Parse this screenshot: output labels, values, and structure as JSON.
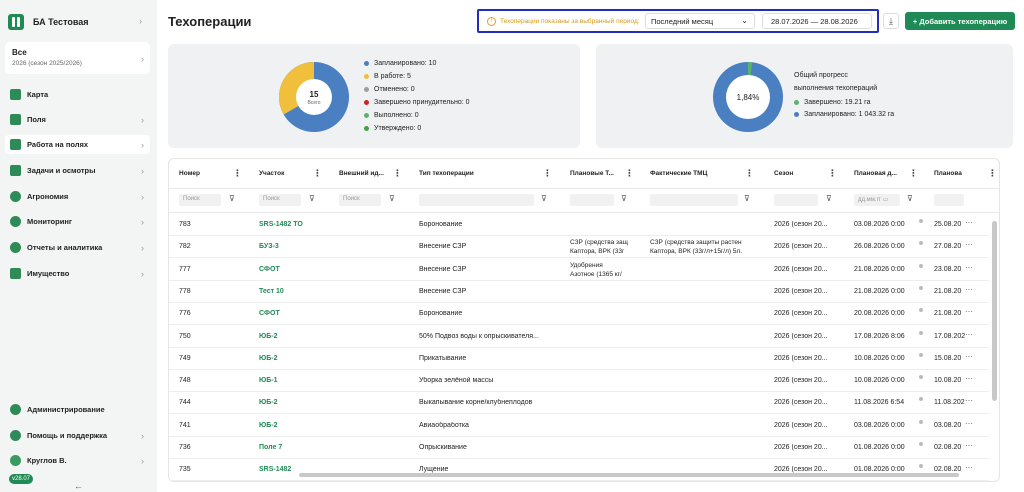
{
  "sidebar": {
    "org_name": "БА Тестовая",
    "season": {
      "title": "Все",
      "subtitle": "2026 (сезон 2025/2026)"
    },
    "items": [
      {
        "label": "Карта",
        "icon": "map-icon"
      },
      {
        "label": "Поля",
        "icon": "fields-icon"
      },
      {
        "label": "Работа на полях",
        "icon": "tractor-icon",
        "active": true
      },
      {
        "label": "Задачи и осмотры",
        "icon": "tasks-icon"
      },
      {
        "label": "Агрономия",
        "icon": "leaf-icon"
      },
      {
        "label": "Мониторинг",
        "icon": "monitoring-icon"
      },
      {
        "label": "Отчеты и аналитика",
        "icon": "chart-icon"
      },
      {
        "label": "Имущество",
        "icon": "warehouse-icon"
      }
    ],
    "bottom": [
      {
        "label": "Администрирование",
        "icon": "gear-icon"
      },
      {
        "label": "Помощь и поддержка",
        "icon": "help-icon"
      },
      {
        "label": "Круглов В.",
        "icon": "avatar"
      }
    ],
    "version": "v28.07"
  },
  "header": {
    "title": "Техоперации",
    "period_note": "Техоперации показаны за выбранный период:",
    "period_value": "Последний месяц",
    "date_range": "28.07.2026 — 28.08.2026",
    "add_button": "+ Добавить техоперацию"
  },
  "status_chart": {
    "center_value": "15",
    "center_label": "Всего",
    "legend": [
      {
        "label": "Запланировано: 10",
        "color": "#4a7fc1"
      },
      {
        "label": "В работе: 5",
        "color": "#f0bf3c"
      },
      {
        "label": "Отменено: 0",
        "color": "#9e9e9e"
      },
      {
        "label": "Завершено принудительно: 0",
        "color": "#c62828"
      },
      {
        "label": "Выполнено: 0",
        "color": "#5cb36d"
      },
      {
        "label": "Утверждено: 0",
        "color": "#43a047"
      }
    ]
  },
  "progress_chart": {
    "center_value": "1,84%",
    "title_line1": "Общий прогресс",
    "title_line2": "выполнения техопераций",
    "legend": [
      {
        "label": "Завершено: 19.21 га",
        "color": "#5cb36d"
      },
      {
        "label": "Запланировано: 1 043.32 га",
        "color": "#4a7fc1"
      }
    ]
  },
  "chart_data": [
    {
      "type": "pie",
      "categories": [
        "Запланировано",
        "В работе"
      ],
      "values": [
        10,
        5
      ]
    },
    {
      "type": "pie",
      "categories": [
        "Завершено",
        "Запланировано"
      ],
      "values": [
        19.21,
        1043.32
      ]
    }
  ],
  "table": {
    "columns": [
      "Номер",
      "Участок",
      "Внешний ид...",
      "Тип техоперации",
      "Плановые Т...",
      "Фактические ТМЦ",
      "Сезон",
      "Плановая д...",
      "Планова"
    ],
    "filters": {
      "number": "Поиск",
      "plot": "Поиск",
      "external": "Поиск",
      "date": "дд.мм.гг"
    },
    "rows": [
      {
        "number": "783",
        "plot": "SRS-1482 TO",
        "type": "Боронование",
        "plan_tmc": "",
        "plan_tmc2": "",
        "fact_tmc": "",
        "fact_tmc2": "",
        "season": "2026 (сезон 20...",
        "plan_date": "03.08.2026 0:00",
        "plan_date2": "25.08.20"
      },
      {
        "number": "782",
        "plot": "БУЗ-3",
        "type": "Внесение СЗР",
        "plan_tmc": "СЗР (средства защ",
        "plan_tmc2": "Каптора, ВРК (33г",
        "fact_tmc": "СЗР (средства защиты растен",
        "fact_tmc2": "Каптора, ВРК (33г/л+15г/л) 5л.",
        "season": "2026 (сезон 20...",
        "plan_date": "26.08.2026 0:00",
        "plan_date2": "27.08.20"
      },
      {
        "number": "777",
        "plot": "СФОТ",
        "type": "Внесение СЗР",
        "plan_tmc": "Удобрения",
        "plan_tmc2": "Азотное (1365 кг/",
        "fact_tmc": "",
        "fact_tmc2": "",
        "season": "2026 (сезон 20...",
        "plan_date": "21.08.2026 0:00",
        "plan_date2": "23.08.20"
      },
      {
        "number": "778",
        "plot": "Тест 10",
        "type": "Внесение СЗР",
        "plan_tmc": "",
        "plan_tmc2": "",
        "fact_tmc": "",
        "fact_tmc2": "",
        "season": "2026 (сезон 20...",
        "plan_date": "21.08.2026 0:00",
        "plan_date2": "21.08.20"
      },
      {
        "number": "776",
        "plot": "СФОТ",
        "type": "Боронование",
        "plan_tmc": "",
        "plan_tmc2": "",
        "fact_tmc": "",
        "fact_tmc2": "",
        "season": "2026 (сезон 20...",
        "plan_date": "20.08.2026 0:00",
        "plan_date2": "21.08.20"
      },
      {
        "number": "750",
        "plot": "ЮБ-2",
        "type": "50% Подвоз воды к опрыскивателя...",
        "plan_tmc": "",
        "plan_tmc2": "",
        "fact_tmc": "",
        "fact_tmc2": "",
        "season": "2026 (сезон 20...",
        "plan_date": "17.08.2026 8:06",
        "plan_date2": "17.08.202"
      },
      {
        "number": "749",
        "plot": "ЮБ-2",
        "type": "Прикатывание",
        "plan_tmc": "",
        "plan_tmc2": "",
        "fact_tmc": "",
        "fact_tmc2": "",
        "season": "2026 (сезон 20...",
        "plan_date": "10.08.2026 0:00",
        "plan_date2": "15.08.20"
      },
      {
        "number": "748",
        "plot": "ЮБ-1",
        "type": "Уборка зелёной массы",
        "plan_tmc": "",
        "plan_tmc2": "",
        "fact_tmc": "",
        "fact_tmc2": "",
        "season": "2026 (сезон 20...",
        "plan_date": "10.08.2026 0:00",
        "plan_date2": "10.08.20"
      },
      {
        "number": "744",
        "plot": "ЮБ-2",
        "type": "Выкапывание корне/клубнеплодов",
        "plan_tmc": "",
        "plan_tmc2": "",
        "fact_tmc": "",
        "fact_tmc2": "",
        "season": "2026 (сезон 20...",
        "plan_date": "11.08.2026 6:54",
        "plan_date2": "11.08.202"
      },
      {
        "number": "741",
        "plot": "ЮБ-2",
        "type": "Авиаобработка",
        "plan_tmc": "",
        "plan_tmc2": "",
        "fact_tmc": "",
        "fact_tmc2": "",
        "season": "2026 (сезон 20...",
        "plan_date": "03.08.2026 0:00",
        "plan_date2": "03.08.20"
      },
      {
        "number": "736",
        "plot": "Поле 7",
        "type": "Опрыскивание",
        "plan_tmc": "",
        "plan_tmc2": "",
        "fact_tmc": "",
        "fact_tmc2": "",
        "season": "2026 (сезон 20...",
        "plan_date": "01.08.2026 0:00",
        "plan_date2": "02.08.20"
      },
      {
        "number": "735",
        "plot": "SRS-1482",
        "type": "Лущение",
        "plan_tmc": "",
        "plan_tmc2": "",
        "fact_tmc": "",
        "fact_tmc2": "",
        "season": "2026 (сезон 20...",
        "plan_date": "01.08.2026 0:00",
        "plan_date2": "02.08.20"
      }
    ]
  }
}
